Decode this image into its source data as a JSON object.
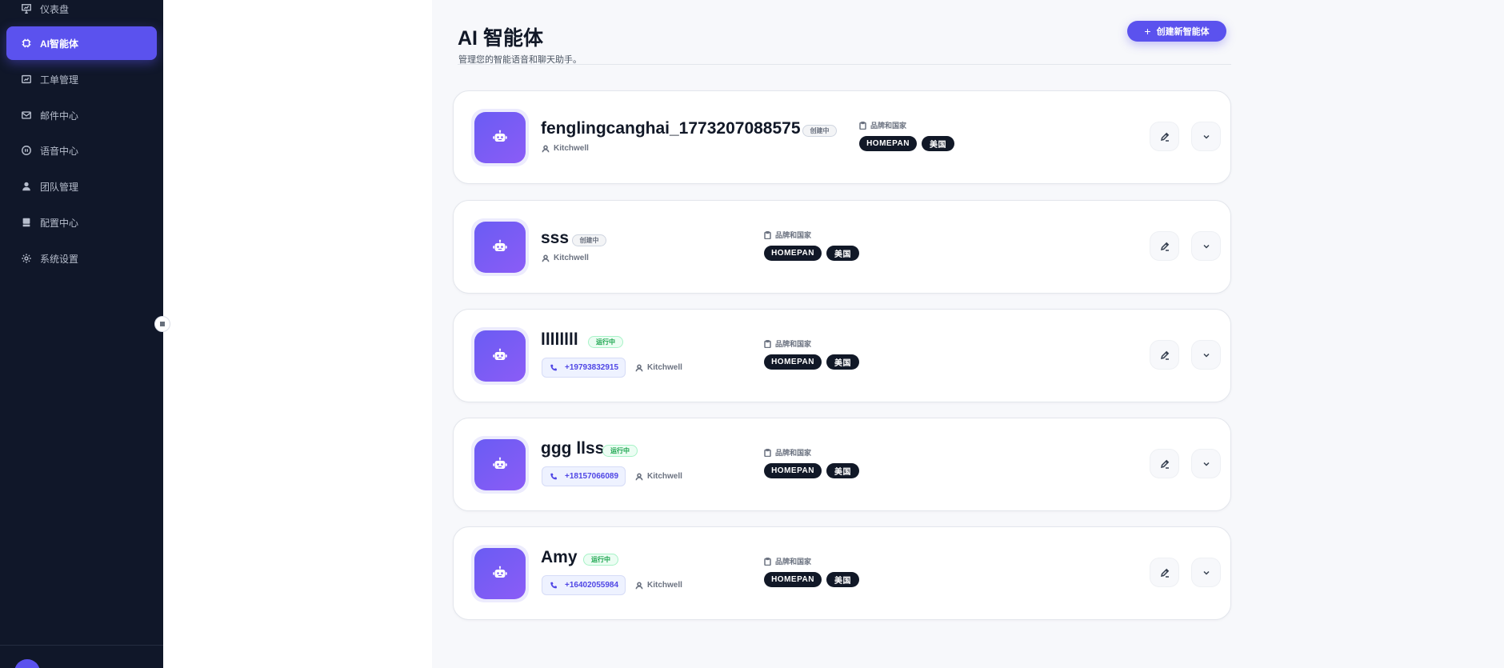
{
  "sidebar": {
    "items": [
      {
        "label": "仪表盘",
        "icon": "presentation-chart-icon",
        "active": false
      },
      {
        "label": "AI智能体",
        "icon": "chip-icon",
        "active": true
      },
      {
        "label": "工单管理",
        "icon": "ticket-icon",
        "active": false
      },
      {
        "label": "邮件中心",
        "icon": "mail-icon",
        "active": false
      },
      {
        "label": "语音中心",
        "icon": "voice-icon",
        "active": false
      },
      {
        "label": "团队管理",
        "icon": "user-icon",
        "active": false
      },
      {
        "label": "配置中心",
        "icon": "server-icon",
        "active": false
      },
      {
        "label": "系统设置",
        "icon": "gear-icon",
        "active": false
      }
    ]
  },
  "header": {
    "title": "AI 智能体",
    "subtitle": "管理您的智能语音和聊天助手。",
    "create_button": "创建新智能体"
  },
  "agents": [
    {
      "name": "fenglingcanghai_1773207088575",
      "status": "创建中",
      "status_type": "creating",
      "phone": "",
      "owner": "Kitchwell",
      "brand_label": "品牌和国家",
      "brand": "HOMEPAN",
      "country": "美国"
    },
    {
      "name": "sss",
      "status": "创建中",
      "status_type": "creating",
      "phone": "",
      "owner": "Kitchwell",
      "brand_label": "品牌和国家",
      "brand": "HOMEPAN",
      "country": "美国"
    },
    {
      "name": "llllllll",
      "status": "运行中",
      "status_type": "running",
      "phone": "+19793832915",
      "owner": "Kitchwell",
      "brand_label": "品牌和国家",
      "brand": "HOMEPAN",
      "country": "美国"
    },
    {
      "name": "ggg llss",
      "status": "运行中",
      "status_type": "running",
      "phone": "+18157066089",
      "owner": "Kitchwell",
      "brand_label": "品牌和国家",
      "brand": "HOMEPAN",
      "country": "美国"
    },
    {
      "name": "Amy",
      "status": "运行中",
      "status_type": "running",
      "phone": "+16402055984",
      "owner": "Kitchwell",
      "brand_label": "品牌和国家",
      "brand": "HOMEPAN",
      "country": "美国"
    }
  ],
  "colors": {
    "sidebar_bg": "#101729",
    "accent": "#5b52ee",
    "running": "#16a34a",
    "chip_bg": "#111827"
  }
}
